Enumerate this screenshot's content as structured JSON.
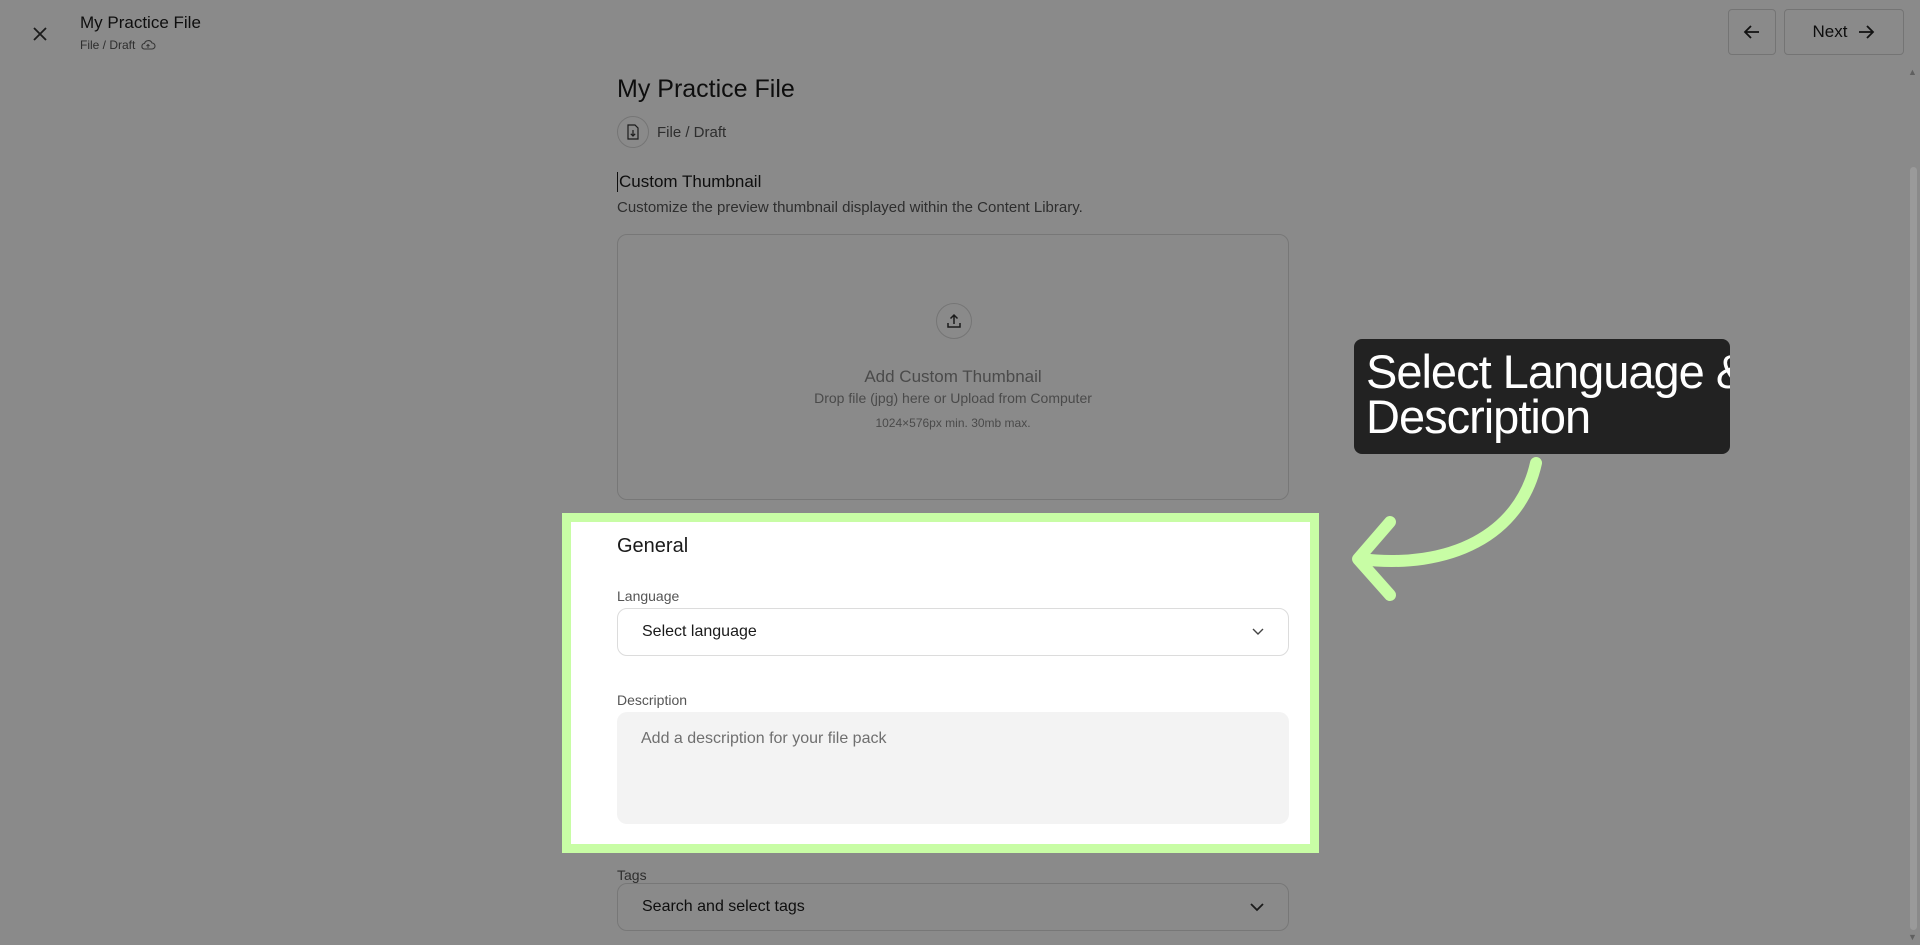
{
  "header": {
    "title": "My Practice File",
    "breadcrumb": "File / Draft",
    "next_label": "Next"
  },
  "file": {
    "title": "My Practice File",
    "breadcrumb": "File / Draft"
  },
  "thumbnail": {
    "heading": "Custom Thumbnail",
    "description": "Customize the preview thumbnail displayed within the Content Library.",
    "dropzone_title": "Add Custom Thumbnail",
    "dropzone_instructions": "Drop file (jpg) here or Upload from Computer",
    "dropzone_requirements": "1024×576px min. 30mb max."
  },
  "general": {
    "heading": "General",
    "language_label": "Language",
    "language_value": "Select language",
    "description_label": "Description",
    "description_placeholder": "Add a description for your file pack"
  },
  "tags": {
    "label": "Tags",
    "value": "Search and select tags"
  },
  "callout": {
    "line1": "Select Language &",
    "line2": "Description"
  },
  "colors": {
    "highlight": "#c8fda5",
    "callout_bg": "#222222"
  },
  "icons": [
    "close-icon",
    "cloud-icon",
    "arrow-left-icon",
    "arrow-right-icon",
    "file-download-icon",
    "upload-icon",
    "chevron-down-icon",
    "curved-arrow-icon"
  ]
}
